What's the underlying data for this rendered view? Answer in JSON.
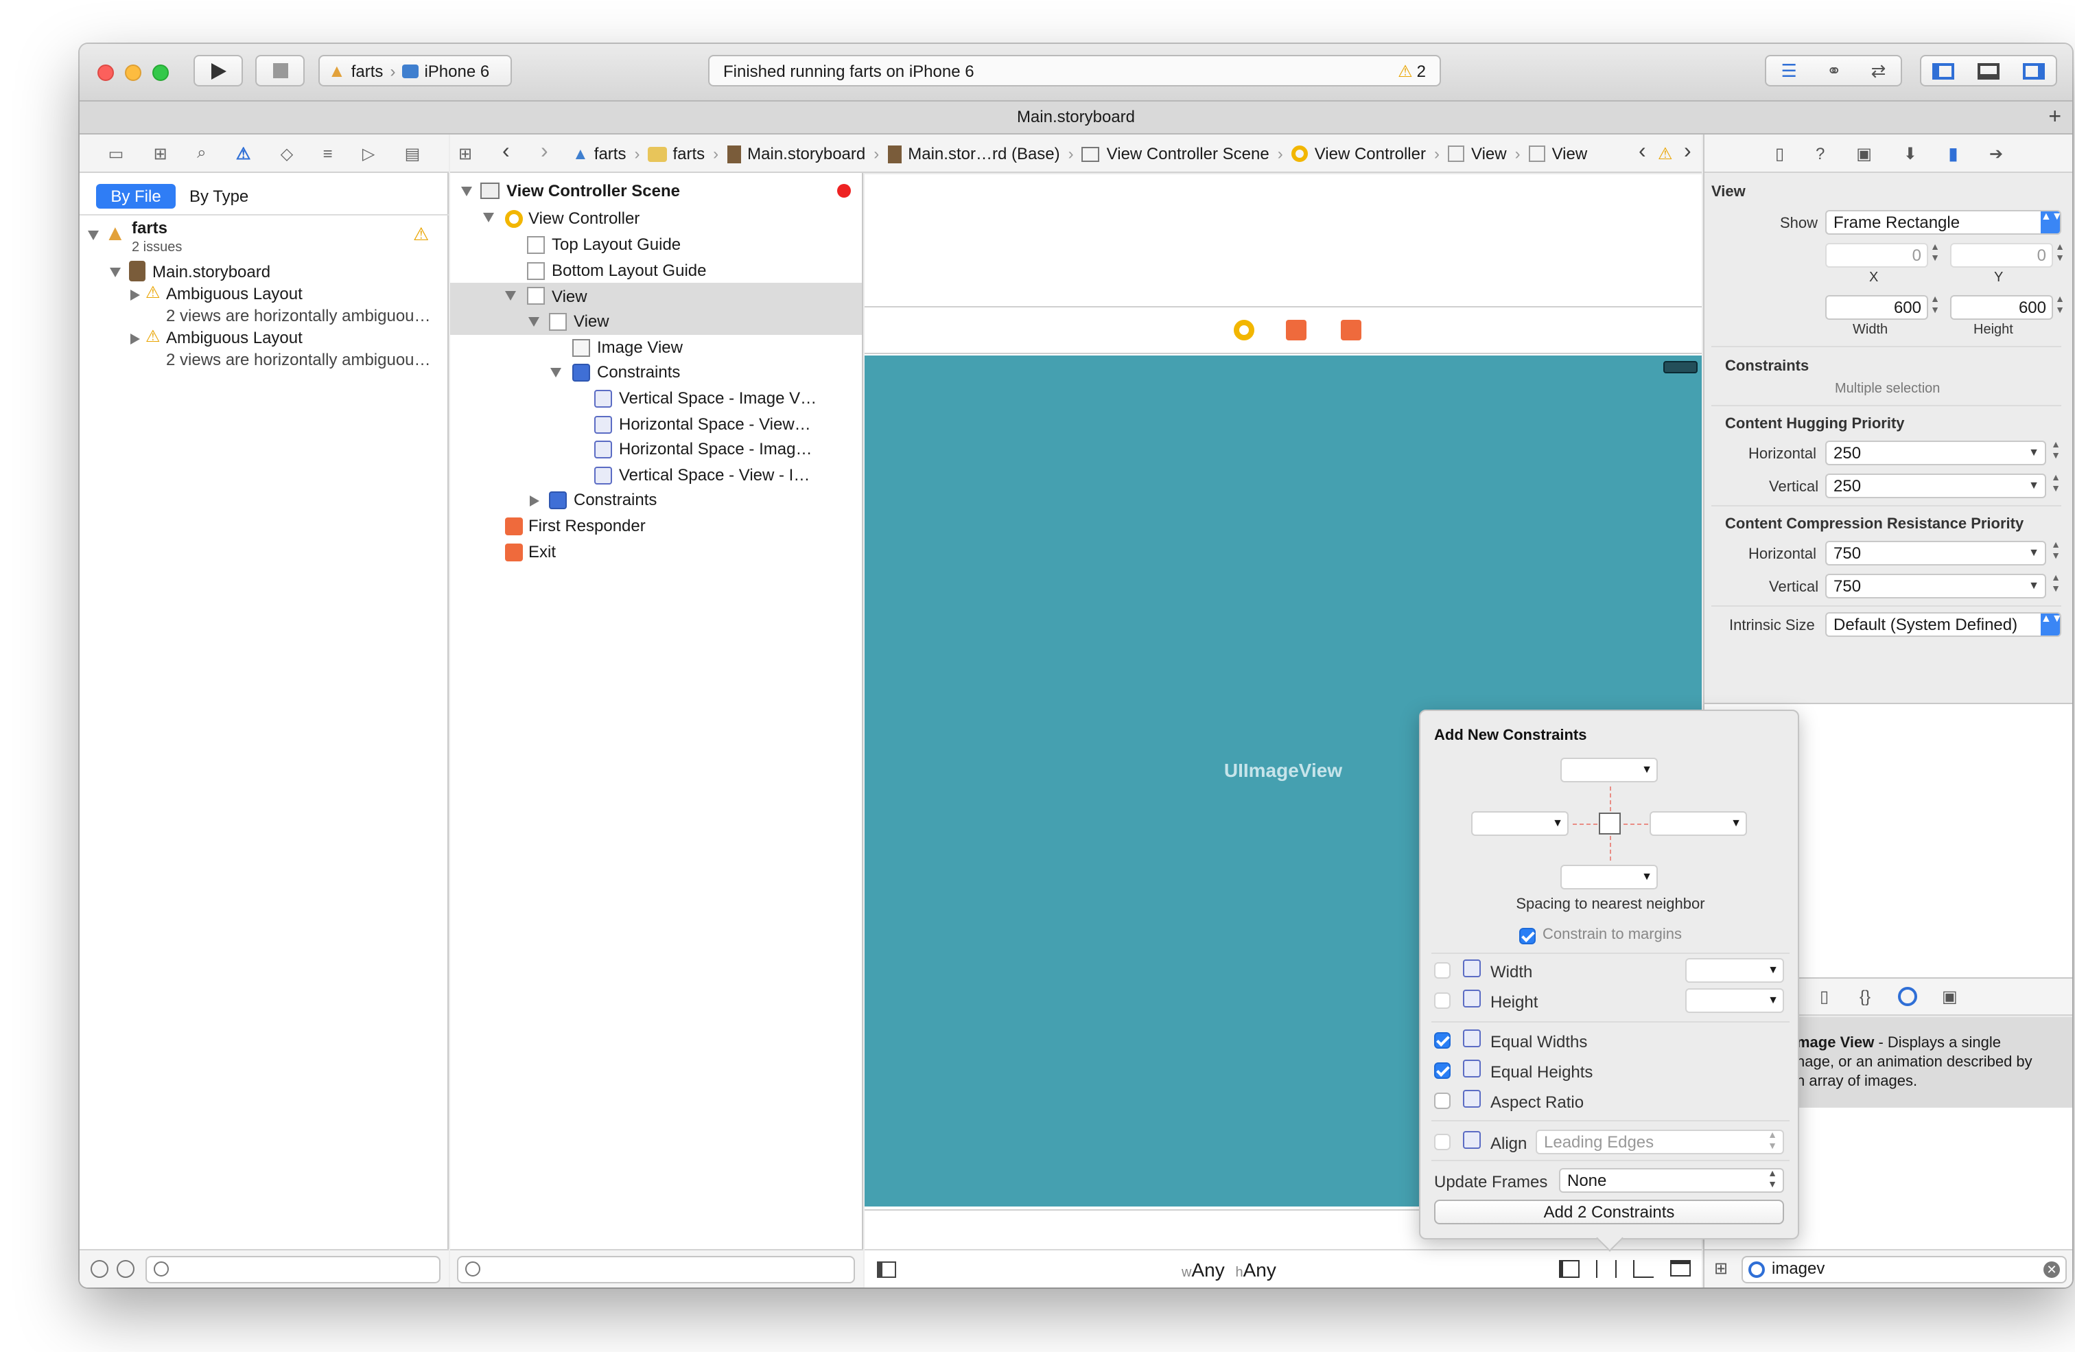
{
  "toolbar": {
    "scheme": "farts",
    "device": "iPhone 6",
    "status": "Finished running farts on iPhone 6",
    "warning_count": "2"
  },
  "tab": {
    "title": "Main.storyboard",
    "add": "+"
  },
  "navigator": {
    "filter_by_file": "By File",
    "filter_by_type": "By Type",
    "project": "farts",
    "project_issues": "2 issues",
    "file": "Main.storyboard",
    "issues": [
      {
        "title": "Ambiguous Layout",
        "detail": "2 views are horizontally ambiguou…"
      },
      {
        "title": "Ambiguous Layout",
        "detail": "2 views are horizontally ambiguou…"
      }
    ]
  },
  "breadcrumb": {
    "items": [
      "farts",
      "farts",
      "Main.storyboard",
      "Main.stor…rd (Base)",
      "View Controller Scene",
      "View Controller",
      "View",
      "View"
    ]
  },
  "outline": {
    "scene": "View Controller Scene",
    "vc": "View Controller",
    "top_guide": "Top Layout Guide",
    "bottom_guide": "Bottom Layout Guide",
    "view": "View",
    "inner_view": "View",
    "image_view": "Image View",
    "constraints": "Constraints",
    "constraint_items": [
      "Vertical Space - Image V…",
      "Horizontal Space - View…",
      "Horizontal Space - Imag…",
      "Vertical Space - View - I…"
    ],
    "constraints2": "Constraints",
    "first_responder": "First Responder",
    "exit": "Exit"
  },
  "canvas": {
    "image_view_label": "UIImageView",
    "size_w_prefix": "w",
    "size_w": "Any",
    "size_h_prefix": "h",
    "size_h": "Any",
    "view_color": "#45a0b0"
  },
  "inspector": {
    "section": "View",
    "show_label": "Show",
    "show_value": "Frame Rectangle",
    "x": "0",
    "y": "0",
    "x_label": "X",
    "y_label": "Y",
    "width": "600",
    "height": "600",
    "width_label": "Width",
    "height_label": "Height",
    "constraints_label": "Constraints",
    "multiple": "Multiple selection",
    "hugging": "Content Hugging Priority",
    "hug_h_label": "Horizontal",
    "hug_h": "250",
    "hug_v_label": "Vertical",
    "hug_v": "250",
    "compression": "Content Compression Resistance Priority",
    "comp_h_label": "Horizontal",
    "comp_h": "750",
    "comp_v_label": "Vertical",
    "comp_v": "750",
    "intrinsic_label": "Intrinsic Size",
    "intrinsic_value": "Default (System Defined)"
  },
  "library": {
    "title": "mage View",
    "desc1": " - Displays a single",
    "desc2": "nage, or an animation described by",
    "desc3": "n array of images.",
    "search": "imagev"
  },
  "popover": {
    "title": "Add New Constraints",
    "spacing_label": "Spacing to nearest neighbor",
    "constrain_margins": "Constrain to margins",
    "width": "Width",
    "height": "Height",
    "equal_widths": "Equal Widths",
    "equal_heights": "Equal Heights",
    "aspect_ratio": "Aspect Ratio",
    "align": "Align",
    "align_value": "Leading Edges",
    "update_frames": "Update Frames",
    "update_value": "None",
    "add_button": "Add 2 Constraints"
  }
}
